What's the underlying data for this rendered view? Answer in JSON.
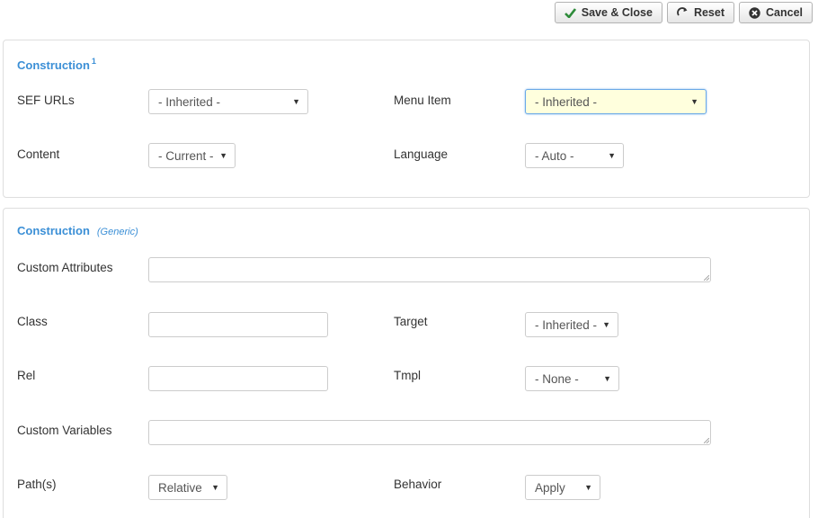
{
  "toolbar": {
    "save_close": "Save & Close",
    "reset": "Reset",
    "cancel": "Cancel"
  },
  "panel1": {
    "legend": "Construction",
    "legend_sup": "1",
    "sef_urls": {
      "label": "SEF URLs",
      "value": "- Inherited -"
    },
    "menu_item": {
      "label": "Menu Item",
      "value": "- Inherited -"
    },
    "content": {
      "label": "Content",
      "value": "- Current -"
    },
    "language": {
      "label": "Language",
      "value": "- Auto -"
    }
  },
  "panel2": {
    "legend": "Construction",
    "legend_note": "(Generic)",
    "custom_attributes": {
      "label": "Custom Attributes",
      "value": ""
    },
    "class": {
      "label": "Class",
      "value": ""
    },
    "target": {
      "label": "Target",
      "value": "- Inherited -"
    },
    "rel": {
      "label": "Rel",
      "value": ""
    },
    "tmpl": {
      "label": "Tmpl",
      "value": "- None -"
    },
    "custom_variables": {
      "label": "Custom Variables",
      "value": ""
    },
    "paths": {
      "label": "Path(s)",
      "value": "Relative"
    },
    "behavior": {
      "label": "Behavior",
      "value": "Apply"
    }
  },
  "colors": {
    "accent": "#3b8fd6",
    "highlight": "#ffffdd",
    "save_icon": "#2e8b3a"
  },
  "icons": {
    "save": "check-icon",
    "reset": "refresh-icon",
    "cancel": "times-circle-icon",
    "dropdown": "caret-down-icon"
  }
}
